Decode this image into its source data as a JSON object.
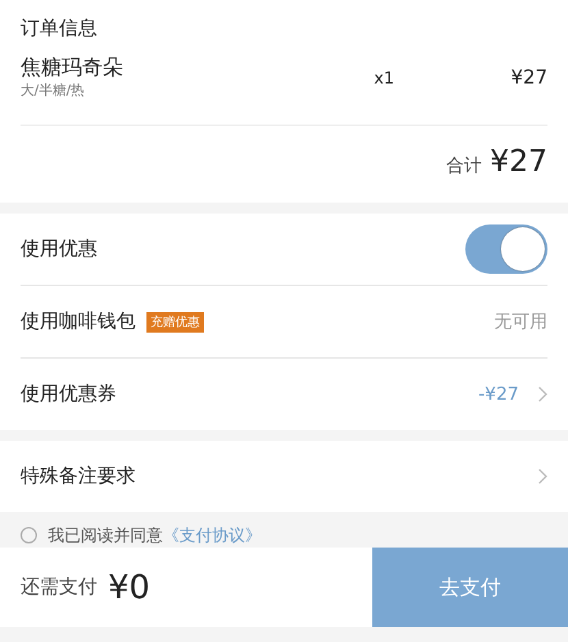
{
  "order": {
    "title": "订单信息",
    "items": [
      {
        "name": "焦糖玛奇朵",
        "options": "大/半糖/热",
        "quantity": "x1",
        "price": "¥27"
      }
    ],
    "total_label": "合计",
    "total": "¥27"
  },
  "discounts": [
    {
      "kind": "toggle",
      "label": "使用优惠",
      "on": true
    },
    {
      "kind": "value",
      "label": "使用咖啡钱包",
      "badge": "充赠优惠",
      "value": "无可用"
    },
    {
      "kind": "link",
      "label": "使用优惠券",
      "value": "-¥27"
    }
  ],
  "remarks": {
    "label": "特殊备注要求"
  },
  "agreement": {
    "checked": false,
    "text": "我已阅读并同意",
    "link": "《支付协议》"
  },
  "footer": {
    "label": "还需支付",
    "amount": "¥0",
    "button": "去支付"
  }
}
